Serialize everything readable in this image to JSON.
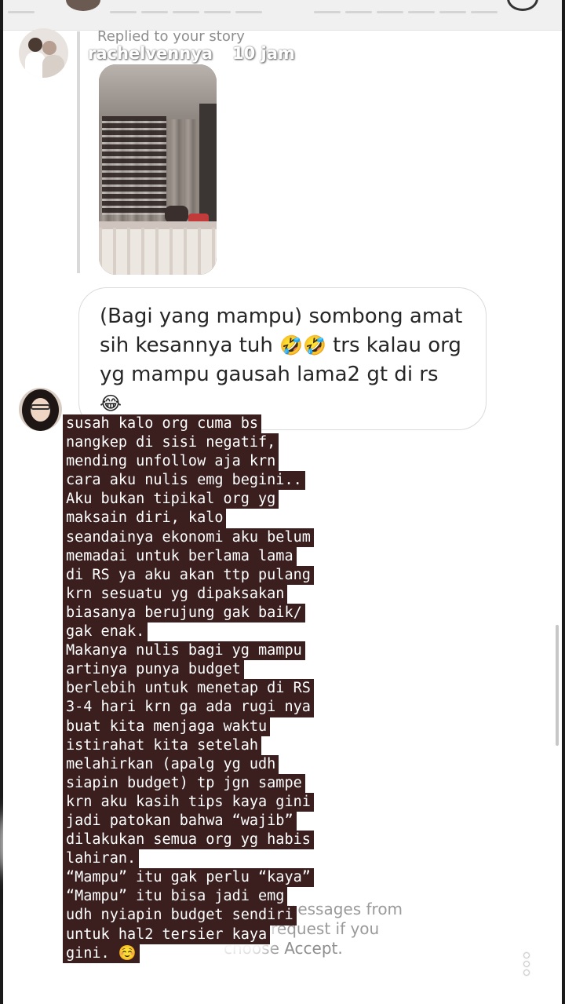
{
  "reply": {
    "replied_label": "Replied to your story",
    "username": "rachelvennya",
    "time": "10 jam"
  },
  "message": {
    "line1": "(Bagi yang mampu) sombong amat",
    "line2_text": "sih kesannya tuh",
    "line2_emoji": "🤣🤣",
    "line2_tail": "trs kalau org",
    "line3_text": "yg mampu gausah lama2 gt di rs",
    "line3_emoji": "😂",
    "line4_emoji": "😂"
  },
  "story_overlay": {
    "lines": [
      "susah kalo org cuma bs",
      "nangkep di sisi negatif,",
      "mending unfollow aja krn",
      "cara aku nulis emg begini..",
      "Aku bukan tipikal org yg",
      "maksain diri, kalo",
      "seandainya ekonomi aku belum",
      "memadai untuk berlama lama",
      "di RS ya aku akan ttp pulang",
      "krn sesuatu yg dipaksakan",
      "biasanya berujung gak baik/",
      "gak enak.",
      "Makanya nulis bagi yg mampu",
      "artinya punya budget",
      "berlebih untuk menetap di RS",
      "3-4 hari krn ga ada rugi nya",
      "buat kita menjaga waktu",
      "istirahat kita setelah",
      "melahirkan (apalg yg udh",
      "siapin budget) tp jgn sampe",
      "krn aku kasih tips kaya gini",
      "jadi patokan bahwa “wajib”",
      "dilakukan semua org yg habis",
      "lahiran.",
      "“Mampu” itu gak perlu “kaya”",
      "“Mampu” itu bisa jadi emg",
      "udh nyiapin budget sendiri",
      "untuk hal2 tersier kaya",
      "gini. ☺️"
    ]
  },
  "system_note": {
    "line1": "nd you messages from",
    "line2": "ir request if you",
    "line3": "choose Accept."
  },
  "icons": {
    "more": "more-vertical-icon"
  }
}
